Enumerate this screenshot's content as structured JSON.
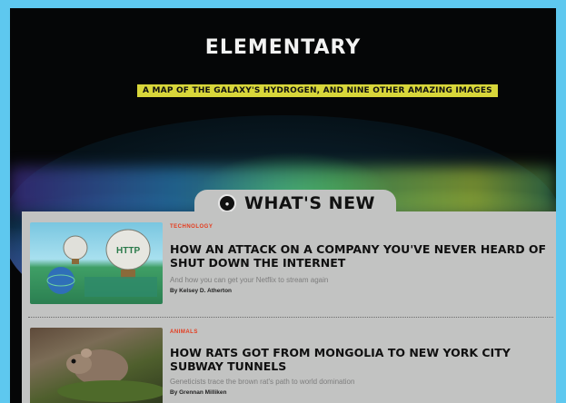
{
  "header": {
    "title": "ELEMENTARY",
    "subtitle": "A MAP OF THE GALAXY'S HYDROGEN, AND NINE OTHER AMAZING IMAGES"
  },
  "section": {
    "label": "WHAT'S NEW",
    "logo_icon": "popsci-logo-icon"
  },
  "articles": [
    {
      "category": "TECHNOLOGY",
      "headline": "HOW AN ATTACK ON A COMPANY YOU'VE NEVER HEARD OF SHUT DOWN THE INTERNET",
      "dek": "And how you can get your Netflix to stream again",
      "byline": "By Kelsey D. Atherton",
      "image_icon": "http-balloons-image"
    },
    {
      "category": "ANIMALS",
      "headline": "HOW RATS GOT FROM MONGOLIA TO NEW YORK CITY SUBWAY TUNNELS",
      "dek": "Geneticists trace the brown rat's path to world domination",
      "byline": "By Grennan Milliken",
      "image_icon": "brown-rat-image"
    }
  ],
  "colors": {
    "page_border": "#5ec8ef",
    "subtitle_highlight": "#d8d63a",
    "category_red": "#e53a1c",
    "panel_gray": "#c2c3c2"
  }
}
